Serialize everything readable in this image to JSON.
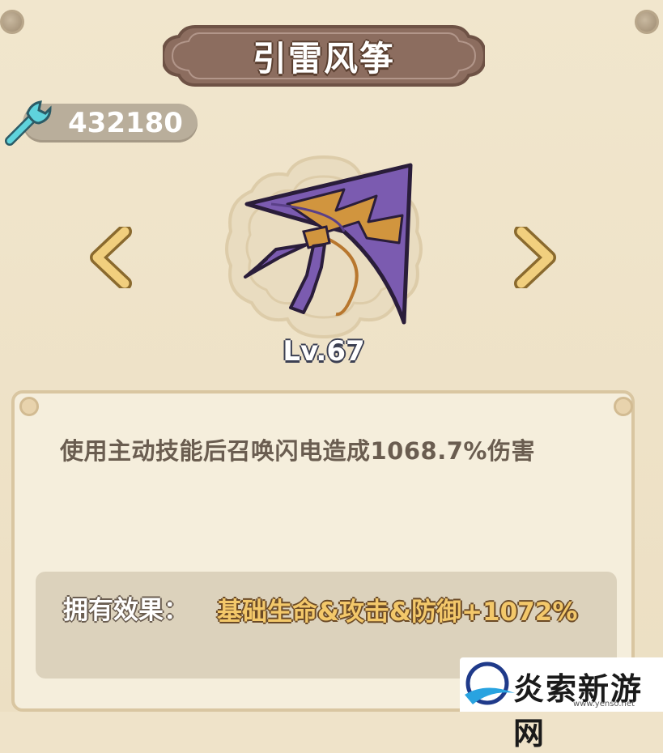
{
  "item": {
    "name": "引雷风筝",
    "level": "Lv.67",
    "description": "使用主动技能后召唤闪电造成1068.7%伤害",
    "effect_label": "拥有效果：",
    "effect_value": "基础生命&攻击&防御+1072%"
  },
  "currency": {
    "icon": "wrench-icon",
    "amount": "432180"
  },
  "navigation": {
    "prev_icon": "chevron-left-icon",
    "next_icon": "chevron-right-icon"
  },
  "watermark": {
    "brand": "炎索新游网",
    "url": "www.yenso.net"
  },
  "colors": {
    "background": "#efe3c9",
    "plaque": "#8c6d5f",
    "kite_purple": "#7b5bb0",
    "effect_gold": "#f3c86a",
    "text_brown": "#6a5d50"
  }
}
